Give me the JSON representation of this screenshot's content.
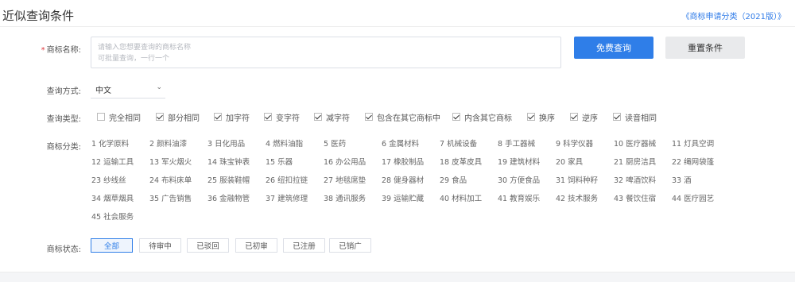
{
  "header": {
    "title": "近似查询条件",
    "link": "《商标申请分类（2021版）》"
  },
  "form": {
    "name_label": "商标名称:",
    "name_required_mark": "*",
    "name_placeholder": "请输入您想要查询的商标名称\n可批量查询，一行一个",
    "search_button": "免费查询",
    "reset_button": "重置条件",
    "method_label": "查询方式:",
    "method_value": "中文",
    "type_label": "查询类型:",
    "types": [
      {
        "label": "完全相同",
        "checked": false
      },
      {
        "label": "部分相同",
        "checked": true
      },
      {
        "label": "加字符",
        "checked": true
      },
      {
        "label": "变字符",
        "checked": true
      },
      {
        "label": "减字符",
        "checked": true
      },
      {
        "label": "包含在其它商标中",
        "checked": true
      },
      {
        "label": "内含其它商标",
        "checked": true
      },
      {
        "label": "换序",
        "checked": true
      },
      {
        "label": "逆序",
        "checked": true
      },
      {
        "label": "读音相同",
        "checked": true
      }
    ],
    "category_label": "商标分类:",
    "categories": [
      "1 化学原料",
      "2 颜料油漆",
      "3 日化用品",
      "4 燃料油脂",
      "5 医药",
      "6 金属材料",
      "7 机械设备",
      "8 手工器械",
      "9 科学仪器",
      "10 医疗器械",
      "11 灯具空调",
      "12 运输工具",
      "13 军火烟火",
      "14 珠宝钟表",
      "15 乐器",
      "16 办公用品",
      "17 橡胶制品",
      "18 皮革皮具",
      "19 建筑材料",
      "20 家具",
      "21 厨房洁具",
      "22 绳网袋篷",
      "23 纱线丝",
      "24 布料床单",
      "25 服装鞋帽",
      "26 纽扣拉链",
      "27 地毯席垫",
      "28 健身器材",
      "29 食品",
      "30 方便食品",
      "31 饲料种籽",
      "32 啤酒饮料",
      "33 酒",
      "34 烟草烟具",
      "35 广告销售",
      "36 金融物管",
      "37 建筑修理",
      "38 通讯服务",
      "39 运输贮藏",
      "40 材料加工",
      "41 教育娱乐",
      "42 技术服务",
      "43 餐饮住宿",
      "44 医疗园艺",
      "45 社会服务"
    ],
    "status_label": "商标状态:",
    "statuses": [
      "全部",
      "待审中",
      "已驳回",
      "已初审",
      "已注册",
      "已销广"
    ]
  }
}
